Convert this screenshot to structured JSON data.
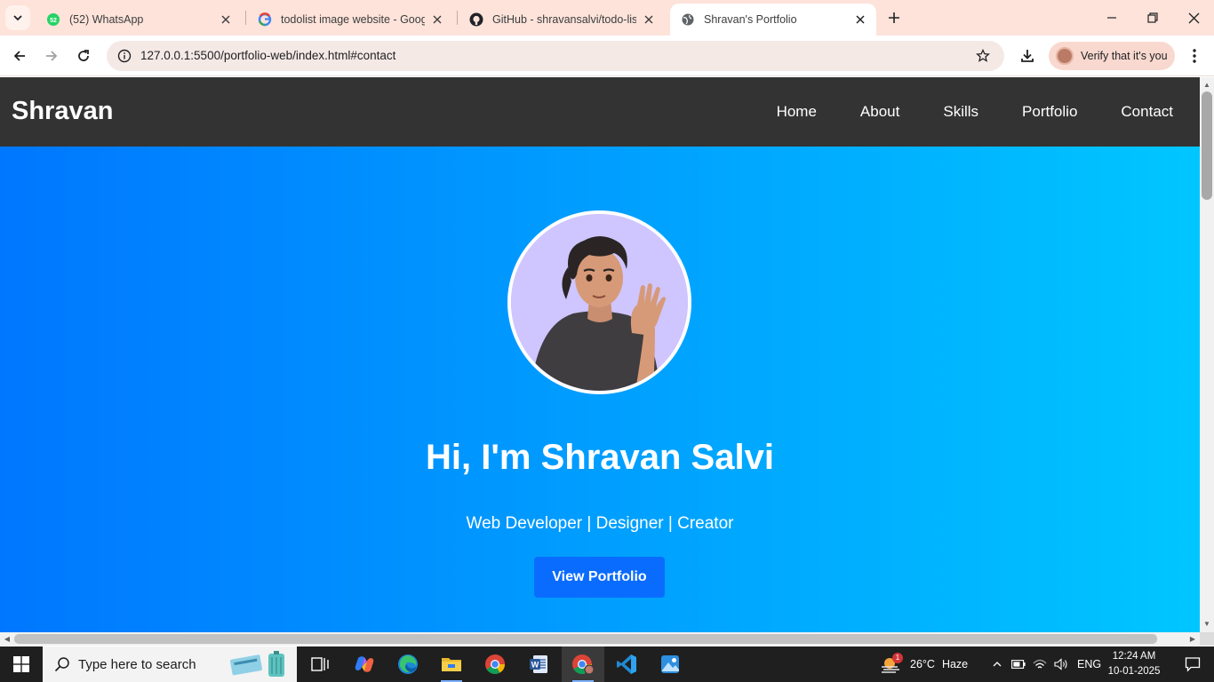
{
  "browser": {
    "tabs": [
      {
        "title": "(52) WhatsApp",
        "badge": "52",
        "icon": "whatsapp-icon"
      },
      {
        "title": "todolist image website - Google",
        "icon": "google-icon"
      },
      {
        "title": "GitHub - shravansalvi/todo-list",
        "icon": "github-icon"
      },
      {
        "title": "Shravan's Portfolio",
        "icon": "globe-icon",
        "active": true
      }
    ],
    "url": "127.0.0.1:5500/portfolio-web/index.html#contact",
    "profile_label": "Verify that it's you"
  },
  "site": {
    "brand": "Shravan",
    "nav": [
      "Home",
      "About",
      "Skills",
      "Portfolio",
      "Contact"
    ],
    "hero": {
      "heading": "Hi, I'm Shravan Salvi",
      "tagline": "Web Developer | Designer | Creator",
      "cta": "View Portfolio"
    },
    "colors": {
      "nav_bg": "#333333",
      "hero_gradient_start": "#0077ff",
      "hero_gradient_end": "#00c6ff",
      "button_bg": "#0a6cff"
    }
  },
  "taskbar": {
    "search_placeholder": "Type here to search",
    "apps": [
      "task-view-icon",
      "copilot-icon",
      "edge-icon",
      "file-explorer-icon",
      "chrome-icon",
      "word-icon",
      "chrome-active-icon",
      "vscode-icon",
      "photos-icon"
    ],
    "weather": {
      "temp": "26°C",
      "condition": "Haze",
      "alert_count": "1"
    },
    "language": "ENG",
    "time": "12:24 AM",
    "date": "10-01-2025"
  }
}
